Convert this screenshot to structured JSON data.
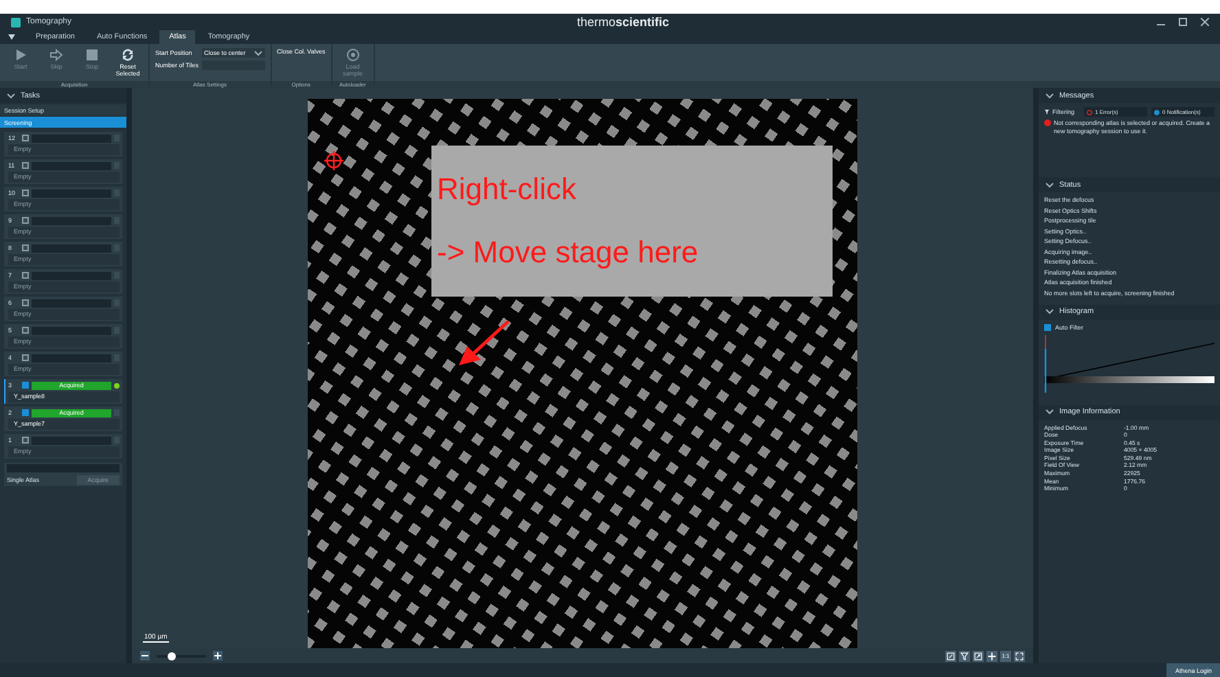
{
  "window": {
    "title": "Tomography",
    "logo": "thermo**scientific**"
  },
  "tabs": [
    {
      "label": "Preparation",
      "selected": false
    },
    {
      "label": "Auto Functions",
      "selected": false
    },
    {
      "label": "Atlas",
      "selected": true
    },
    {
      "label": "Tomography",
      "selected": false
    }
  ],
  "ribbon": [
    {
      "label": "Acquisition",
      "items": [
        {
          "kind": "button",
          "label": "Start",
          "disabled": true
        },
        {
          "kind": "button",
          "label": "Skip",
          "disabled": true
        },
        {
          "kind": "button",
          "label": "Stop",
          "disabled": true
        },
        {
          "kind": "button",
          "label": "Reset Selected",
          "disabled": false
        }
      ]
    },
    {
      "label": "Atlas Settings",
      "items": [
        {
          "kind": "dropdown",
          "label": "Start Position",
          "value": "Close to center"
        },
        {
          "kind": "field",
          "label": "Number of Tiles"
        }
      ]
    },
    {
      "label": "Options",
      "items": [
        {
          "kind": "text",
          "label": "Close Col. Valves"
        }
      ]
    },
    {
      "label": "Autoloader",
      "items": [
        {
          "kind": "button",
          "label": "Load sample",
          "disabled": true
        }
      ]
    }
  ],
  "tasks": {
    "header": "Tasks",
    "sections": [
      {
        "label": "Session Setup",
        "selected": false
      },
      {
        "label": "Screening",
        "selected": true
      }
    ],
    "items": [
      {
        "number": "12",
        "checked": false,
        "name": "Empty",
        "selected": false
      },
      {
        "number": "11",
        "checked": false,
        "name": "Empty",
        "selected": false
      },
      {
        "number": "10",
        "checked": false,
        "name": "Empty",
        "selected": false
      },
      {
        "number": "9",
        "checked": false,
        "name": "Empty",
        "selected": false
      },
      {
        "number": "8",
        "checked": false,
        "name": "Empty",
        "selected": false
      },
      {
        "number": "7",
        "checked": false,
        "name": "Empty",
        "selected": false
      },
      {
        "number": "6",
        "checked": false,
        "name": "Empty",
        "selected": false
      },
      {
        "number": "5",
        "checked": false,
        "name": "Empty",
        "selected": false
      },
      {
        "number": "4",
        "checked": false,
        "name": "Empty",
        "selected": false
      },
      {
        "number": "3",
        "checked": true,
        "status": "Acquired",
        "name": "Y_sample8",
        "selected": true
      },
      {
        "number": "2",
        "checked": true,
        "status": "Acquired",
        "name": "Y_sample7",
        "selected": false
      },
      {
        "number": "1",
        "checked": false,
        "name": "Empty",
        "selected": false
      }
    ],
    "single_atlas": {
      "label": "Single Atlas",
      "button": "Acquire",
      "disabled": true
    }
  },
  "viewer": {
    "annotation": [
      "Right-click",
      "-> Move stage here"
    ],
    "scale_bar": "100 µm",
    "zoom": {
      "level": 0.3
    },
    "ratio_button": "1:1"
  },
  "messages": {
    "header": "Messages",
    "filter_label": "Filtering",
    "errors": "1 Error(s)",
    "notifications": "0 Notification(s)",
    "items": [
      {
        "kind": "error",
        "text": "Not corresponding atlas is selected or acquired. Create a new tomography session to use it."
      }
    ]
  },
  "status": {
    "header": "Status",
    "items": [
      "Reset the defocus",
      "Reset Optics Shifts",
      "Postprocessing tile",
      "Setting Optics..",
      "Setting Defocus..",
      "Acquiring image..",
      "Resetting defocus..",
      "Finalizing Atlas acquisition",
      "Atlas acquisition finished",
      "No more slots left to acquire, screening finished"
    ]
  },
  "histogram": {
    "header": "Histogram",
    "auto_filter": {
      "label": "Auto Filter",
      "checked": true
    }
  },
  "image_info": {
    "header": "Image Information",
    "rows": [
      {
        "label": "Applied Defocus",
        "value": "-1.00 mm"
      },
      {
        "label": "Dose",
        "value": "0"
      },
      {
        "label": "Exposure Time",
        "value": "0.45 s"
      },
      {
        "label": "Image Size",
        "value": "4005 × 4005"
      },
      {
        "label": "Pixel Size",
        "value": "529.49 nm"
      },
      {
        "label": "Field Of View",
        "value": "2.12 mm"
      },
      {
        "label": "Maximum",
        "value": "22925"
      },
      {
        "label": "Mean",
        "value": "1776.76"
      },
      {
        "label": "Minimum",
        "value": "0"
      }
    ]
  },
  "status_bar": {
    "button": "Athena Login"
  }
}
